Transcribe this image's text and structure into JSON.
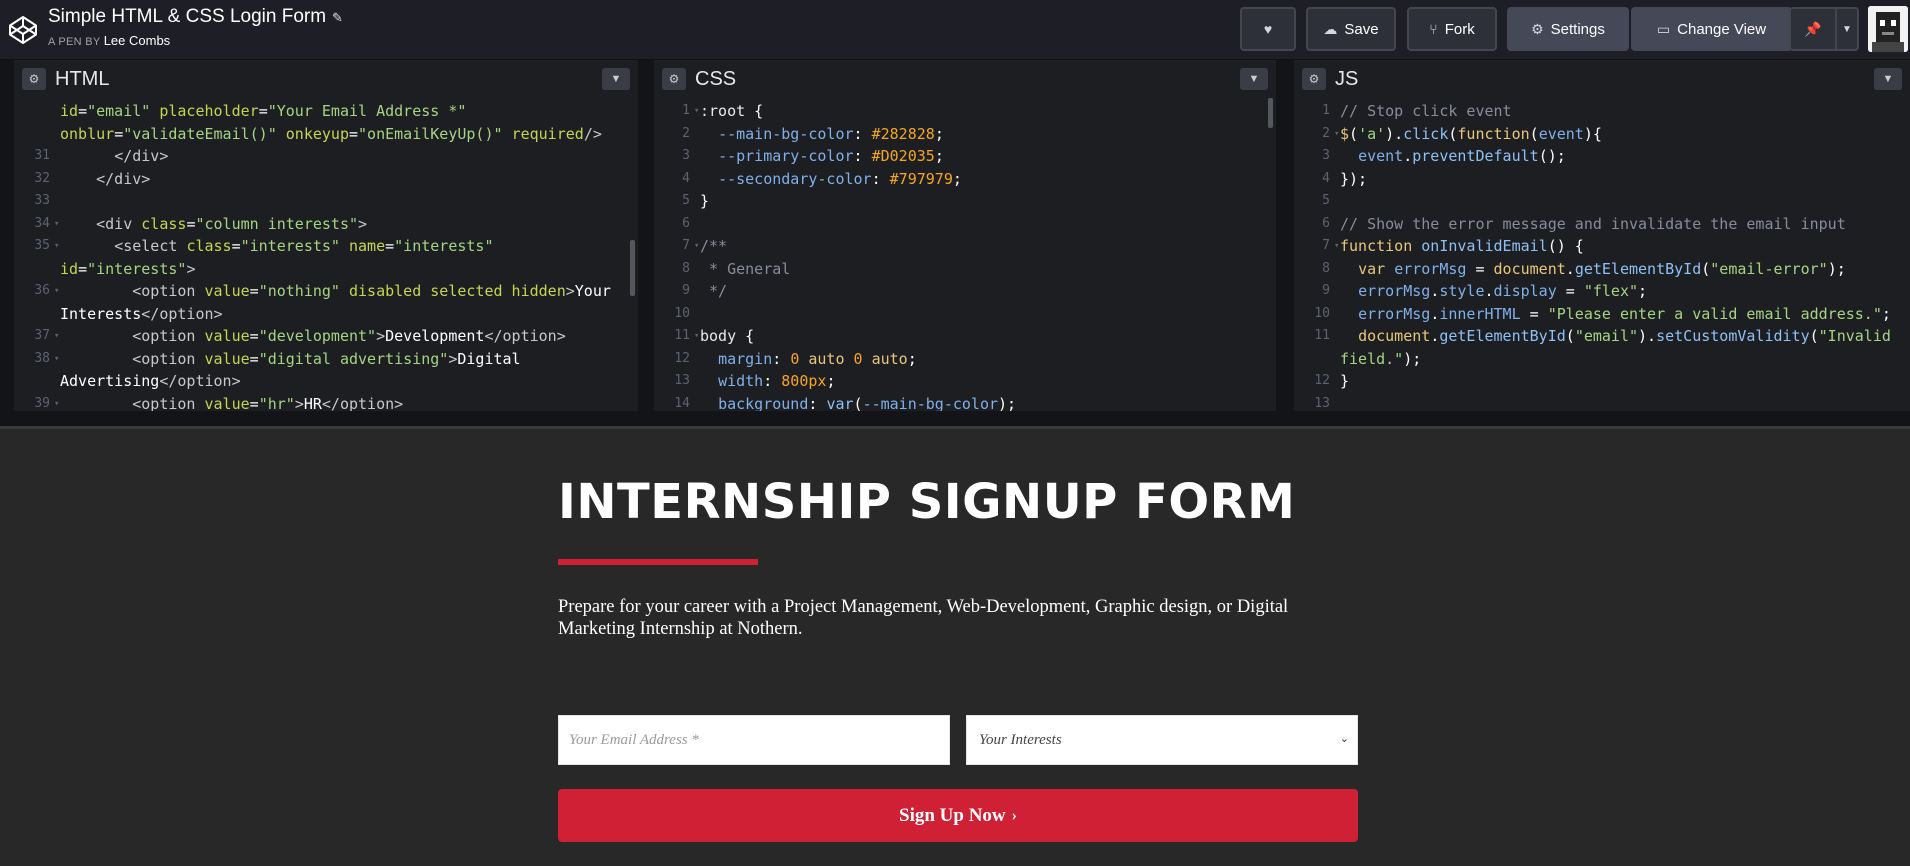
{
  "header": {
    "pen_title": "Simple HTML & CSS Login Form",
    "byline_prefix": "A PEN BY",
    "author": "Lee Combs",
    "buttons": {
      "save": "Save",
      "fork": "Fork",
      "settings": "Settings",
      "change_view": "Change View"
    },
    "icons": [
      "codepen-logo-icon",
      "pencil-icon",
      "heart-icon",
      "cloud-icon",
      "fork-icon",
      "gear-icon",
      "layout-icon",
      "pin-icon",
      "chevron-down-icon"
    ]
  },
  "panes": {
    "html": {
      "title": "HTML",
      "lines": [
        {
          "n": "",
          "f": "",
          "html": "<span class='t-attr'>id</span>=<span class='t-str'>\"email\"</span> <span class='t-attr'>placeholder</span>=<span class='t-str'>\"Your Email Address *\"</span>"
        },
        {
          "n": "",
          "f": "",
          "html": "<span class='t-attr'>onblur</span>=<span class='t-str'>\"validateEmail()\"</span> <span class='t-attr'>onkeyup</span>=<span class='t-str'>\"onEmailKeyUp()\"</span> <span class='t-attr'>required</span><span class='t-tag'>/></span>"
        },
        {
          "n": "31",
          "f": "",
          "html": "      <span class='t-tag'>&lt;/div></span>"
        },
        {
          "n": "32",
          "f": "",
          "html": "    <span class='t-tag'>&lt;/div></span>"
        },
        {
          "n": "33",
          "f": "",
          "html": ""
        },
        {
          "n": "34",
          "f": "▾",
          "html": "    <span class='t-tag'>&lt;div</span> <span class='t-attr'>class</span>=<span class='t-str'>\"column interests\"</span><span class='t-tag'>></span>"
        },
        {
          "n": "35",
          "f": "▾",
          "html": "      <span class='t-tag'>&lt;select</span> <span class='t-attr'>class</span>=<span class='t-str'>\"interests\"</span> <span class='t-attr'>name</span>=<span class='t-str'>\"interests\"</span>"
        },
        {
          "n": "",
          "f": "",
          "html": "<span class='t-attr'>id</span>=<span class='t-str'>\"interests\"</span><span class='t-tag'>></span>"
        },
        {
          "n": "36",
          "f": "▾",
          "html": "        <span class='t-tag'>&lt;option</span> <span class='t-attr'>value</span>=<span class='t-str'>\"nothing\"</span> <span class='t-attr'>disabled selected hidden</span><span class='t-tag'>></span>Your"
        },
        {
          "n": "",
          "f": "",
          "html": "Interests<span class='t-tag'>&lt;/option></span>"
        },
        {
          "n": "37",
          "f": "▾",
          "html": "        <span class='t-tag'>&lt;option</span> <span class='t-attr'>value</span>=<span class='t-str'>\"development\"</span><span class='t-tag'>></span>Development<span class='t-tag'>&lt;/option></span>"
        },
        {
          "n": "38",
          "f": "▾",
          "html": "        <span class='t-tag'>&lt;option</span> <span class='t-attr'>value</span>=<span class='t-str'>\"digital advertising\"</span><span class='t-tag'>></span>Digital"
        },
        {
          "n": "",
          "f": "",
          "html": "Advertising<span class='t-tag'>&lt;/option></span>"
        },
        {
          "n": "39",
          "f": "▾",
          "html": "        <span class='t-tag'>&lt;option</span> <span class='t-attr'>value</span>=<span class='t-str'>\"hr\"</span><span class='t-tag'>></span>HR<span class='t-tag'>&lt;/option></span>"
        }
      ]
    },
    "css": {
      "title": "CSS",
      "lines": [
        {
          "n": "1",
          "f": "▾",
          "html": "<span class='t-sel'>:root</span> {"
        },
        {
          "n": "2",
          "f": "",
          "html": "  <span class='t-prop'>--main-bg-color</span>: <span class='t-num'>#282828</span>;"
        },
        {
          "n": "3",
          "f": "",
          "html": "  <span class='t-prop'>--primary-color</span>: <span class='t-num'>#D02035</span>;"
        },
        {
          "n": "4",
          "f": "",
          "html": "  <span class='t-prop'>--secondary-color</span>: <span class='t-num'>#797979</span>;"
        },
        {
          "n": "5",
          "f": "",
          "html": "}"
        },
        {
          "n": "6",
          "f": "",
          "html": ""
        },
        {
          "n": "7",
          "f": "▾",
          "html": "<span class='t-com'>/**</span>"
        },
        {
          "n": "8",
          "f": "",
          "html": "<span class='t-com'> * General</span>"
        },
        {
          "n": "9",
          "f": "",
          "html": "<span class='t-com'> */</span>"
        },
        {
          "n": "10",
          "f": "",
          "html": ""
        },
        {
          "n": "11",
          "f": "▾",
          "html": "<span class='t-sel'>body</span> {"
        },
        {
          "n": "12",
          "f": "",
          "html": "  <span class='t-prop'>margin</span>: <span class='t-num'>0</span> <span class='t-kw'>auto</span> <span class='t-num'>0</span> <span class='t-kw'>auto</span>;"
        },
        {
          "n": "13",
          "f": "",
          "html": "  <span class='t-prop'>width</span>: <span class='t-num'>800px</span>;"
        },
        {
          "n": "14",
          "f": "",
          "html": "  <span class='t-prop'>background</span>: <span class='t-fn'>var</span>(<span class='t-prop'>--main-bg-color</span>);"
        }
      ]
    },
    "js": {
      "title": "JS",
      "lines": [
        {
          "n": "1",
          "f": "",
          "html": "<span class='t-com'>// Stop click event</span>"
        },
        {
          "n": "2",
          "f": "▾",
          "html": "<span class='t-kw'>$</span>(<span class='t-str'>'a'</span>).<span class='t-fn'>click</span>(<span class='t-kw'>function</span>(<span class='t-prop'>event</span>){"
        },
        {
          "n": "3",
          "f": "",
          "html": "  <span class='t-prop'>event</span>.<span class='t-fn'>preventDefault</span>();"
        },
        {
          "n": "4",
          "f": "",
          "html": "});"
        },
        {
          "n": "5",
          "f": "",
          "html": ""
        },
        {
          "n": "6",
          "f": "",
          "html": "<span class='t-com'>// Show the error message and invalidate the email input</span>"
        },
        {
          "n": "7",
          "f": "▾",
          "html": "<span class='t-kw'>function</span> <span class='t-fn'>onInvalidEmail</span>() {"
        },
        {
          "n": "8",
          "f": "",
          "html": "  <span class='t-kw'>var</span> <span class='t-prop'>errorMsg</span> = <span class='t-kw'>document</span>.<span class='t-fn'>getElementById</span>(<span class='t-str'>\"email-error\"</span>);"
        },
        {
          "n": "9",
          "f": "",
          "html": "  <span class='t-prop'>errorMsg</span>.<span class='t-prop'>style</span>.<span class='t-prop'>display</span> = <span class='t-str'>\"flex\"</span>;"
        },
        {
          "n": "10",
          "f": "",
          "html": "  <span class='t-prop'>errorMsg</span>.<span class='t-prop'>innerHTML</span> = <span class='t-str'>\"Please enter a valid email address.\"</span>;"
        },
        {
          "n": "11",
          "f": "",
          "html": "  <span class='t-kw'>document</span>.<span class='t-fn'>getElementById</span>(<span class='t-str'>\"email\"</span>).<span class='t-fn'>setCustomValidity</span>(<span class='t-str'>\"Invalid</span>"
        },
        {
          "n": "",
          "f": "",
          "html": "<span class='t-str'>field.\"</span>);"
        },
        {
          "n": "12",
          "f": "",
          "html": "}"
        },
        {
          "n": "13",
          "f": "",
          "html": ""
        }
      ]
    }
  },
  "preview": {
    "title": "INTERNSHIP SIGNUP FORM",
    "description": "Prepare for your career with a Project Management, Web-Development, Graphic design, or Digital Marketing Internship at Nothern.",
    "email_placeholder": "Your Email Address *",
    "interests_selected": "Your Interests",
    "signup_label": "Sign Up Now",
    "primary_color": "#D02035",
    "bg_color": "#282828"
  }
}
